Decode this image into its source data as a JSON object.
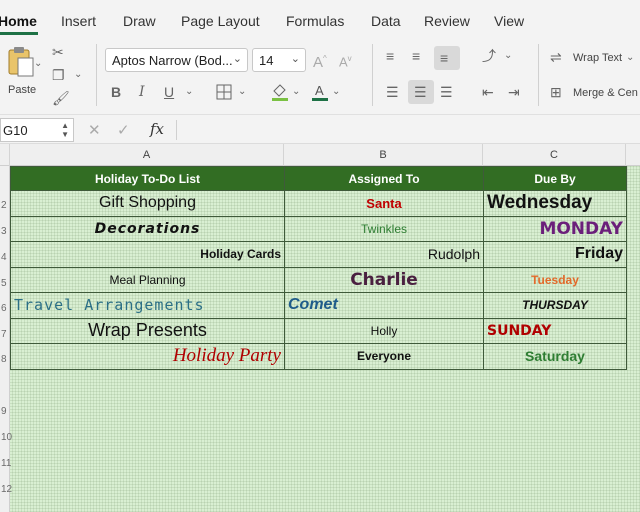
{
  "ribbon_tabs": [
    "Home",
    "Insert",
    "Draw",
    "Page Layout",
    "Formulas",
    "Data",
    "Review",
    "View"
  ],
  "ribbon": {
    "paste_label": "Paste",
    "font_name": "Aptos Narrow (Bod...",
    "font_size": "14",
    "bold": "B",
    "italic": "I",
    "underline": "U",
    "wrap_text": "Wrap Text",
    "merge_center": "Merge & Cen",
    "font_color": "#c00000",
    "highlight_color": "#7ac143"
  },
  "formula_bar": {
    "name_box": "G10",
    "fx": "fx",
    "value": ""
  },
  "columns": [
    "A",
    "B",
    "C"
  ],
  "row_numbers": [
    "2",
    "3",
    "4",
    "5",
    "6",
    "7",
    "8",
    "9",
    "10",
    "11",
    "12"
  ],
  "table": {
    "headers": [
      "Holiday To-Do List",
      "Assigned To",
      "Due By"
    ],
    "rows": [
      [
        "Gift Shopping",
        "Santa",
        "Wednesday"
      ],
      [
        "Decorations",
        "Twinkles",
        "MONDAY"
      ],
      [
        "Holiday Cards",
        "Rudolph",
        "Friday"
      ],
      [
        "Meal Planning",
        "Charlie",
        "Tuesday"
      ],
      [
        "Travel Arrangements",
        "Comet",
        "THURSDAY"
      ],
      [
        "Wrap Presents",
        "Holly",
        "SUNDAY"
      ],
      [
        "Holiday Party",
        "Everyone",
        "Saturday"
      ]
    ]
  },
  "colors": {
    "header_green": "#326d23",
    "sheet_green": "#d9efd2",
    "santa_red": "#c00000",
    "twinkles_green": "#2e7d32",
    "monday_purple": "#6b1f7a",
    "tuesday_orange": "#e2692a",
    "comet_blue": "#1f5c8a",
    "travel_teal": "#2b6f86",
    "party_red": "#b00000",
    "sunday_red": "#b00000",
    "saturday_green": "#2e7d32"
  }
}
